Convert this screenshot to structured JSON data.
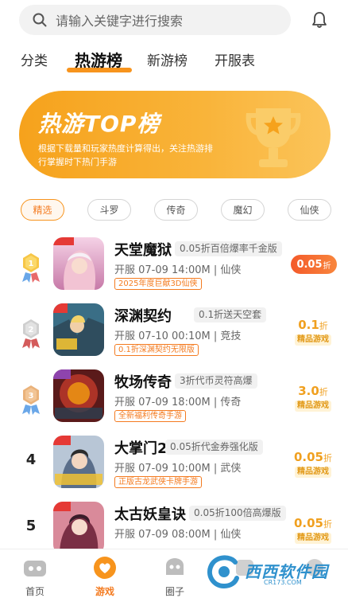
{
  "search": {
    "placeholder": "请输入关键字进行搜索"
  },
  "tabs": [
    {
      "label": "分类"
    },
    {
      "label": "热游榜"
    },
    {
      "label": "新游榜"
    },
    {
      "label": "开服表"
    }
  ],
  "banner": {
    "title": "热游TOP榜",
    "desc": "根据下载量和玩家热度计算得出，关注热游排行掌握时下热门手游"
  },
  "filters": [
    "精选",
    "斗罗",
    "传奇",
    "魔幻",
    "仙侠"
  ],
  "games": [
    {
      "rank": "1",
      "name": "天堂魔狱",
      "tag": "0.05折百倍爆率千金版",
      "meta": "开服 07-09 14:00M | 仙侠",
      "promo": "2025年度巨献3D仙侠",
      "discount": "0.05",
      "unit": "折",
      "badge": ""
    },
    {
      "rank": "2",
      "name": "深渊契约",
      "tag": "0.1折送天空套",
      "meta": "开服 07-10 00:10M | 竞技",
      "promo": "0.1折深渊契约无限版",
      "discount": "0.1",
      "unit": "折",
      "badge": "精品游戏"
    },
    {
      "rank": "3",
      "name": "牧场传奇",
      "tag": "3折代币灵符高爆",
      "meta": "开服 07-09 18:00M | 传奇",
      "promo": "全新福利传奇手游",
      "discount": "3.0",
      "unit": "折",
      "badge": "精品游戏"
    },
    {
      "rank": "4",
      "name": "大掌门2",
      "tag": "0.05折代金券强化版",
      "meta": "开服 07-09 10:00M | 武侠",
      "promo": "正版古龙武侠卡牌手游",
      "discount": "0.05",
      "unit": "折",
      "badge": "精品游戏"
    },
    {
      "rank": "5",
      "name": "太古妖皇诀",
      "tag": "0.05折100倍高爆版",
      "meta": "开服 07-09 08:00M | 仙侠",
      "promo": "",
      "discount": "0.05",
      "unit": "折",
      "badge": "精品游戏"
    }
  ],
  "nav": [
    {
      "label": "首页"
    },
    {
      "label": "游戏"
    },
    {
      "label": "圈子"
    },
    {
      "label": ""
    },
    {
      "label": ""
    }
  ],
  "watermark": {
    "text": "西西软件园",
    "sub": "CR173.COM"
  },
  "colors": {
    "accent": "#f7941d",
    "discount_red": "#f45a2a",
    "badge_gold": "#f0a020"
  }
}
